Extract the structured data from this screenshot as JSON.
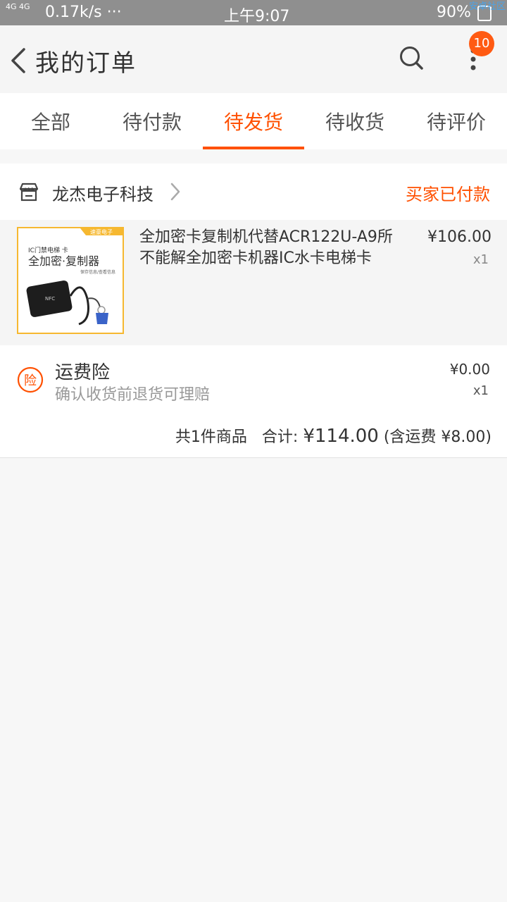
{
  "status_bar": {
    "signal": "4G 4G",
    "speed": "0.17k/s ···",
    "time": "上午9:07",
    "battery": "90%",
    "watermark": "安卓社区"
  },
  "header": {
    "title": "我的订单",
    "badge_count": "10"
  },
  "tabs": [
    {
      "label": "全部"
    },
    {
      "label": "待付款"
    },
    {
      "label": "待发货"
    },
    {
      "label": "待收货"
    },
    {
      "label": "待评价"
    }
  ],
  "active_tab": "待发货",
  "order": {
    "shop_name": "龙杰电子科技",
    "status": "买家已付款",
    "item": {
      "title": "全加密卡复制机代替ACR122U-A9所不能解全加密卡机器IC水卡电梯卡",
      "price": "¥106.00",
      "quantity": "x1",
      "thumb": {
        "tag": "速豪电子",
        "line1": "IC门禁电梯 卡",
        "line2": "全加密·复制器",
        "line3": "保存信息/查看信息",
        "nfc": "NFC"
      }
    },
    "insurance": {
      "icon_char": "险",
      "title": "运费险",
      "subtitle": "确认收货前退货可理赔",
      "price": "¥0.00",
      "quantity": "x1"
    },
    "summary": {
      "count_text": "共1件商品",
      "total_label": "合计:",
      "total": "¥114.00",
      "shipping_note": "(含运费 ¥8.00)"
    }
  },
  "colors": {
    "accent": "#ff5000",
    "status_bar": "#8f8f8f",
    "badge": "#ff5a12"
  }
}
